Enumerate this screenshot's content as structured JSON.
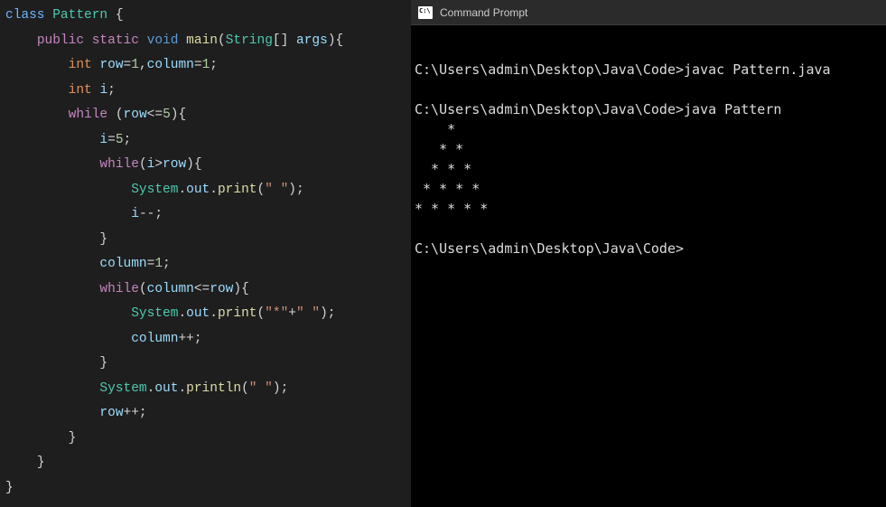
{
  "editor": {
    "lines": [
      {
        "indent": 0,
        "tokens": [
          {
            "t": "class ",
            "c": "kw-class"
          },
          {
            "t": "Pattern ",
            "c": "cls-name"
          },
          {
            "t": "{",
            "c": "punct"
          }
        ]
      },
      {
        "indent": 1,
        "tokens": [
          {
            "t": "public ",
            "c": "kw-mod"
          },
          {
            "t": "static ",
            "c": "kw-mod"
          },
          {
            "t": "void ",
            "c": "kw-type"
          },
          {
            "t": "main",
            "c": "method"
          },
          {
            "t": "(",
            "c": "punct"
          },
          {
            "t": "String",
            "c": "cls-name"
          },
          {
            "t": "[] ",
            "c": "punct"
          },
          {
            "t": "args",
            "c": "var"
          },
          {
            "t": "){",
            "c": "punct"
          }
        ]
      },
      {
        "indent": 2,
        "tokens": [
          {
            "t": "int ",
            "c": "kw-int"
          },
          {
            "t": "row",
            "c": "var"
          },
          {
            "t": "=",
            "c": "punct"
          },
          {
            "t": "1",
            "c": "num"
          },
          {
            "t": ",",
            "c": "punct"
          },
          {
            "t": "column",
            "c": "var"
          },
          {
            "t": "=",
            "c": "punct"
          },
          {
            "t": "1",
            "c": "num"
          },
          {
            "t": ";",
            "c": "punct"
          }
        ]
      },
      {
        "indent": 2,
        "tokens": [
          {
            "t": "int ",
            "c": "kw-int"
          },
          {
            "t": "i",
            "c": "var"
          },
          {
            "t": ";",
            "c": "punct"
          }
        ]
      },
      {
        "indent": 2,
        "tokens": [
          {
            "t": "while ",
            "c": "kw-ctrl"
          },
          {
            "t": "(",
            "c": "punct"
          },
          {
            "t": "row",
            "c": "var"
          },
          {
            "t": "<=",
            "c": "punct"
          },
          {
            "t": "5",
            "c": "num"
          },
          {
            "t": "){",
            "c": "punct"
          }
        ]
      },
      {
        "indent": 3,
        "tokens": [
          {
            "t": "i",
            "c": "var"
          },
          {
            "t": "=",
            "c": "punct"
          },
          {
            "t": "5",
            "c": "num"
          },
          {
            "t": ";",
            "c": "punct"
          }
        ]
      },
      {
        "indent": 3,
        "tokens": [
          {
            "t": "while",
            "c": "kw-ctrl"
          },
          {
            "t": "(",
            "c": "punct"
          },
          {
            "t": "i",
            "c": "var"
          },
          {
            "t": ">",
            "c": "punct"
          },
          {
            "t": "row",
            "c": "var"
          },
          {
            "t": "){",
            "c": "punct"
          }
        ]
      },
      {
        "indent": 4,
        "tokens": [
          {
            "t": "System",
            "c": "cls-name"
          },
          {
            "t": ".",
            "c": "punct"
          },
          {
            "t": "out",
            "c": "var"
          },
          {
            "t": ".",
            "c": "punct"
          },
          {
            "t": "print",
            "c": "method"
          },
          {
            "t": "(",
            "c": "punct"
          },
          {
            "t": "\" \"",
            "c": "str"
          },
          {
            "t": ");",
            "c": "punct"
          }
        ]
      },
      {
        "indent": 4,
        "tokens": [
          {
            "t": "i",
            "c": "var"
          },
          {
            "t": "--;",
            "c": "punct"
          }
        ]
      },
      {
        "indent": 3,
        "tokens": [
          {
            "t": "}",
            "c": "punct"
          }
        ]
      },
      {
        "indent": 3,
        "tokens": [
          {
            "t": "column",
            "c": "var"
          },
          {
            "t": "=",
            "c": "punct"
          },
          {
            "t": "1",
            "c": "num"
          },
          {
            "t": ";",
            "c": "punct"
          }
        ]
      },
      {
        "indent": 3,
        "tokens": [
          {
            "t": "while",
            "c": "kw-ctrl"
          },
          {
            "t": "(",
            "c": "punct"
          },
          {
            "t": "column",
            "c": "var"
          },
          {
            "t": "<=",
            "c": "punct"
          },
          {
            "t": "row",
            "c": "var"
          },
          {
            "t": "){",
            "c": "punct"
          }
        ]
      },
      {
        "indent": 4,
        "tokens": [
          {
            "t": "System",
            "c": "cls-name"
          },
          {
            "t": ".",
            "c": "punct"
          },
          {
            "t": "out",
            "c": "var"
          },
          {
            "t": ".",
            "c": "punct"
          },
          {
            "t": "print",
            "c": "method"
          },
          {
            "t": "(",
            "c": "punct"
          },
          {
            "t": "\"*\"",
            "c": "str"
          },
          {
            "t": "+",
            "c": "punct"
          },
          {
            "t": "\" \"",
            "c": "str"
          },
          {
            "t": ");",
            "c": "punct"
          }
        ]
      },
      {
        "indent": 4,
        "tokens": [
          {
            "t": "column",
            "c": "var"
          },
          {
            "t": "++;",
            "c": "punct"
          }
        ]
      },
      {
        "indent": 3,
        "tokens": [
          {
            "t": "}",
            "c": "punct"
          }
        ]
      },
      {
        "indent": 3,
        "tokens": [
          {
            "t": "System",
            "c": "cls-name"
          },
          {
            "t": ".",
            "c": "punct"
          },
          {
            "t": "out",
            "c": "var"
          },
          {
            "t": ".",
            "c": "punct"
          },
          {
            "t": "println",
            "c": "method"
          },
          {
            "t": "(",
            "c": "punct"
          },
          {
            "t": "\" \"",
            "c": "str"
          },
          {
            "t": ");",
            "c": "punct"
          }
        ]
      },
      {
        "indent": 3,
        "tokens": [
          {
            "t": "row",
            "c": "var"
          },
          {
            "t": "++;",
            "c": "punct"
          }
        ]
      },
      {
        "indent": 2,
        "tokens": [
          {
            "t": "}",
            "c": "punct"
          }
        ]
      },
      {
        "indent": 1,
        "tokens": [
          {
            "t": "}",
            "c": "punct"
          }
        ]
      },
      {
        "indent": 0,
        "tokens": [
          {
            "t": "}",
            "c": "punct"
          }
        ]
      }
    ]
  },
  "terminal": {
    "title": "Command Prompt",
    "lines": [
      "",
      "C:\\Users\\admin\\Desktop\\Java\\Code>javac Pattern.java",
      "",
      "C:\\Users\\admin\\Desktop\\Java\\Code>java Pattern",
      "    *",
      "   * *",
      "  * * *",
      " * * * *",
      "* * * * *",
      "",
      "C:\\Users\\admin\\Desktop\\Java\\Code>"
    ]
  }
}
